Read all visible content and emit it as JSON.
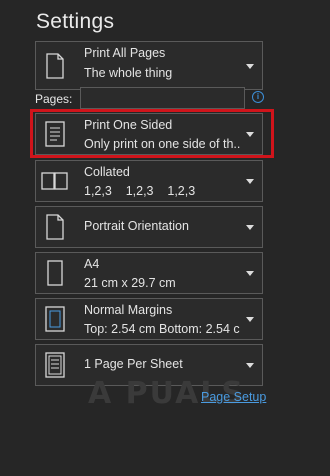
{
  "title": "Settings",
  "print_what": {
    "line1": "Print All Pages",
    "line2": "The whole thing",
    "icon": "document-icon"
  },
  "pages": {
    "label": "Pages:",
    "value": "",
    "placeholder": ""
  },
  "sides": {
    "line1": "Print One Sided",
    "line2": "Only print on one side of th...",
    "icon": "one-sided-page-icon"
  },
  "collate": {
    "line1": "Collated",
    "line2": "1,2,3    1,2,3    1,2,3",
    "icon": "collated-pages-icon"
  },
  "orientation": {
    "line1": "Portrait Orientation",
    "icon": "portrait-page-icon"
  },
  "paper": {
    "line1": "A4",
    "line2": "21 cm x 29.7 cm",
    "icon": "paper-size-icon"
  },
  "margins": {
    "line1": "Normal Margins",
    "line2": "Top: 2.54 cm Bottom: 2.54 c...",
    "icon": "margins-icon"
  },
  "per_sheet": {
    "line1": "1 Page Per Sheet",
    "icon": "pages-per-sheet-icon"
  },
  "page_setup_link": "Page Setup",
  "watermark": "A PUALS",
  "colors": {
    "background": "#262626",
    "accent_link": "#4a9be0",
    "highlight_box": "#d0141b"
  }
}
